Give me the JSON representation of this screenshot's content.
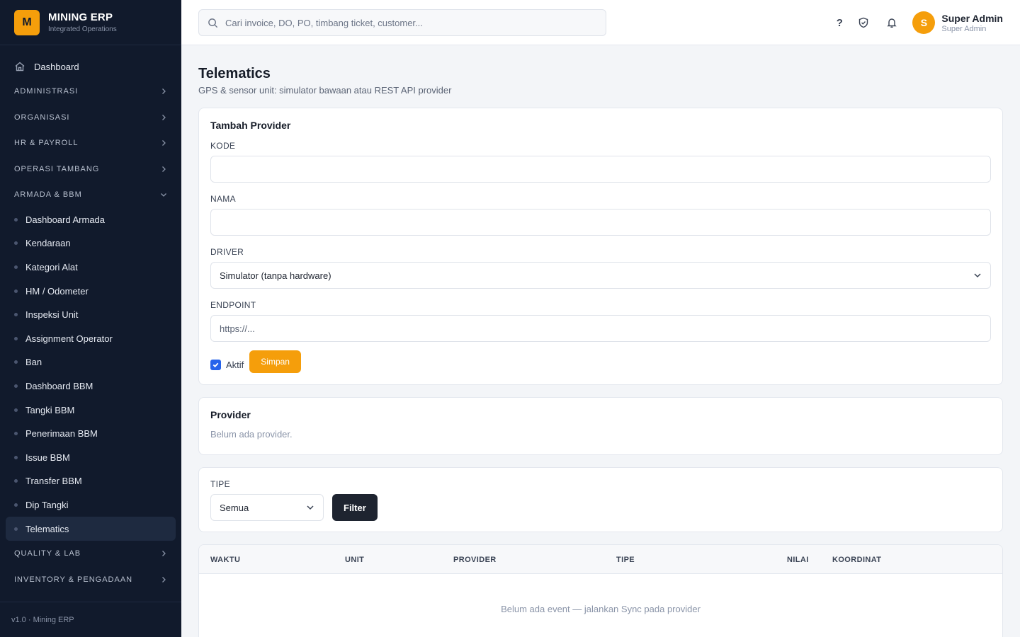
{
  "brand": {
    "logo_letter": "M",
    "name": "MINING ERP",
    "subtitle": "Integrated Operations"
  },
  "sidebar": {
    "dashboard": "Dashboard",
    "sections_top": [
      "ADMINISTRASI",
      "ORGANISASI",
      "HR & PAYROLL",
      "OPERASI TAMBANG"
    ],
    "expanded_section": "ARMADA & BBM",
    "items": [
      "Dashboard Armada",
      "Kendaraan",
      "Kategori Alat",
      "HM / Odometer",
      "Inspeksi Unit",
      "Assignment Operator",
      "Ban",
      "Dashboard BBM",
      "Tangki BBM",
      "Penerimaan BBM",
      "Issue BBM",
      "Transfer BBM",
      "Dip Tangki",
      "Telematics"
    ],
    "active_item": "Telematics",
    "sections_bottom": [
      "QUALITY & LAB",
      "INVENTORY & PENGADAAN"
    ],
    "footer": "v1.0 · Mining ERP"
  },
  "topbar": {
    "search_placeholder": "Cari invoice, DO, PO, timbang ticket, customer...",
    "help_glyph": "?",
    "avatar_letter": "S",
    "user_name": "Super Admin",
    "user_role": "Super Admin"
  },
  "page": {
    "title": "Telematics",
    "subtitle": "GPS & sensor unit: simulator bawaan atau REST API provider"
  },
  "form": {
    "title": "Tambah Provider",
    "kode_label": "KODE",
    "kode_value": "",
    "nama_label": "NAMA",
    "nama_value": "",
    "driver_label": "DRIVER",
    "driver_value": "Simulator (tanpa hardware)",
    "endpoint_label": "ENDPOINT",
    "endpoint_placeholder": "https://...",
    "aktif_label": "Aktif",
    "aktif_checked": true,
    "save_label": "Simpan"
  },
  "providers": {
    "title": "Provider",
    "empty": "Belum ada provider."
  },
  "filter": {
    "tipe_label": "TIPE",
    "tipe_value": "Semua",
    "button": "Filter"
  },
  "events_table": {
    "columns": [
      "WAKTU",
      "UNIT",
      "PROVIDER",
      "TIPE",
      "NILAI",
      "KOORDINAT"
    ],
    "empty": "Belum ada event — jalankan Sync pada provider"
  },
  "colors": {
    "sidebar_bg": "#111a2c",
    "accent": "#f59e0b",
    "checkbox": "#2563eb",
    "dark_button": "#1e2430"
  }
}
